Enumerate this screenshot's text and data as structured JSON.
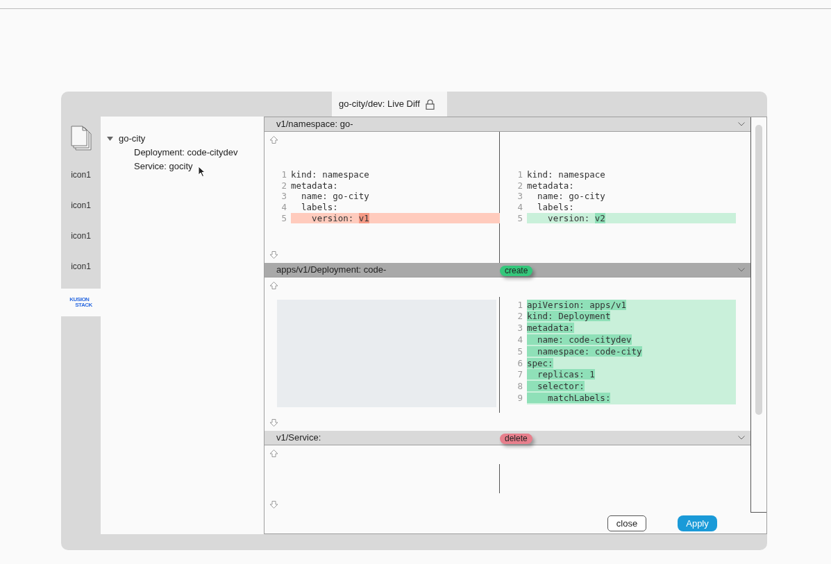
{
  "dialog": {
    "tab": {
      "title": "go-city/dev: Live Diff",
      "locked": true
    }
  },
  "sidebar": {
    "items": [
      {
        "kind": "docs",
        "selected": false
      },
      {
        "kind": "text",
        "label": "icon1",
        "selected": false
      },
      {
        "kind": "text",
        "label": "icon1",
        "selected": false
      },
      {
        "kind": "text",
        "label": "icon1",
        "selected": false
      },
      {
        "kind": "text",
        "label": "icon1",
        "selected": false
      },
      {
        "kind": "logo",
        "logo_lines": [
          "KUSION",
          "STACK"
        ],
        "selected": true
      }
    ]
  },
  "tree": [
    {
      "label": "go-city",
      "expanded": true,
      "children": [
        {
          "label": "Deployment: code-citydev"
        },
        {
          "label": "Service: gocity"
        }
      ]
    }
  ],
  "sections": [
    {
      "title": "v1/namespace: go-",
      "selected": false,
      "left": {
        "kind": "code",
        "lines": [
          {
            "num": "1",
            "kind": "same",
            "text": "kind: namespace"
          },
          {
            "num": "2",
            "kind": "same",
            "text": "metadata:"
          },
          {
            "num": "3",
            "kind": "same",
            "text": "  name: go-city"
          },
          {
            "num": "4",
            "kind": "same",
            "text": "  labels:"
          },
          {
            "num": "5",
            "kind": "removed",
            "text": "    version: ",
            "changed": "v1"
          }
        ]
      },
      "right": {
        "kind": "code",
        "lines": [
          {
            "num": "1",
            "kind": "same",
            "text": "kind: namespace"
          },
          {
            "num": "2",
            "kind": "same",
            "text": "metadata:"
          },
          {
            "num": "3",
            "kind": "same",
            "text": "  name: go-city"
          },
          {
            "num": "4",
            "kind": "same",
            "text": "  labels:"
          },
          {
            "num": "5",
            "kind": "added",
            "text": "    version: ",
            "changed": "v2"
          }
        ]
      }
    },
    {
      "title": "apps/v1/Deployment: code-",
      "selected": true,
      "status": "create",
      "left": {
        "kind": "blank"
      },
      "right": {
        "kind": "code",
        "lines": [
          {
            "num": "1",
            "kind": "added",
            "changed": "apiVersion: apps/v1"
          },
          {
            "num": "2",
            "kind": "added",
            "changed": "kind: Deployment"
          },
          {
            "num": "3",
            "kind": "added",
            "changed": "metadata:"
          },
          {
            "num": "4",
            "kind": "added",
            "changed": "  name: code-citydev"
          },
          {
            "num": "5",
            "kind": "added",
            "changed": "  namespace: code-city"
          },
          {
            "num": "6",
            "kind": "added",
            "changed": "spec:"
          },
          {
            "num": "7",
            "kind": "added",
            "changed": "  replicas: 1"
          },
          {
            "num": "8",
            "kind": "added",
            "changed": "  selector:"
          },
          {
            "num": "9",
            "kind": "added",
            "changed": "    matchLabels:"
          }
        ]
      }
    },
    {
      "title": "v1/Service:",
      "selected": false,
      "status": "delete",
      "left": {
        "kind": "empty"
      },
      "right": {
        "kind": "empty"
      }
    }
  ],
  "buttons": [
    {
      "label": "close",
      "kind": "secondary"
    },
    {
      "label": "Apply",
      "kind": "primary"
    }
  ]
}
